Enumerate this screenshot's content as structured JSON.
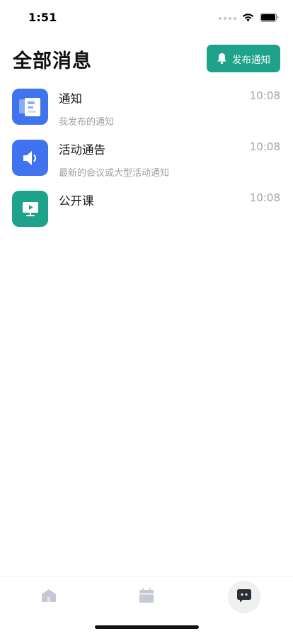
{
  "status_bar": {
    "time": "1:51"
  },
  "header": {
    "title": "全部消息",
    "publish_button_label": "发布通知",
    "publish_button_icon": "bell-icon"
  },
  "messages": [
    {
      "title": "通知",
      "preview": "我发布的通知",
      "time": "10:08",
      "icon": "document-icon",
      "color": "#3f73f0"
    },
    {
      "title": "活动通告",
      "preview": "最新的会议或大型活动通知",
      "time": "10:08",
      "icon": "speaker-icon",
      "color": "#3f73f0"
    },
    {
      "title": "公开课",
      "preview": "",
      "time": "10:08",
      "icon": "video-screen-icon",
      "color": "#1fa28b"
    }
  ],
  "tab_bar": {
    "tabs": [
      {
        "icon": "home-icon",
        "active": false
      },
      {
        "icon": "calendar-icon",
        "active": false
      },
      {
        "icon": "chat-icon",
        "active": true
      }
    ]
  },
  "colors": {
    "accent": "#1fa28b",
    "blue": "#3f73f0",
    "muted_text": "#a3a3a3"
  }
}
